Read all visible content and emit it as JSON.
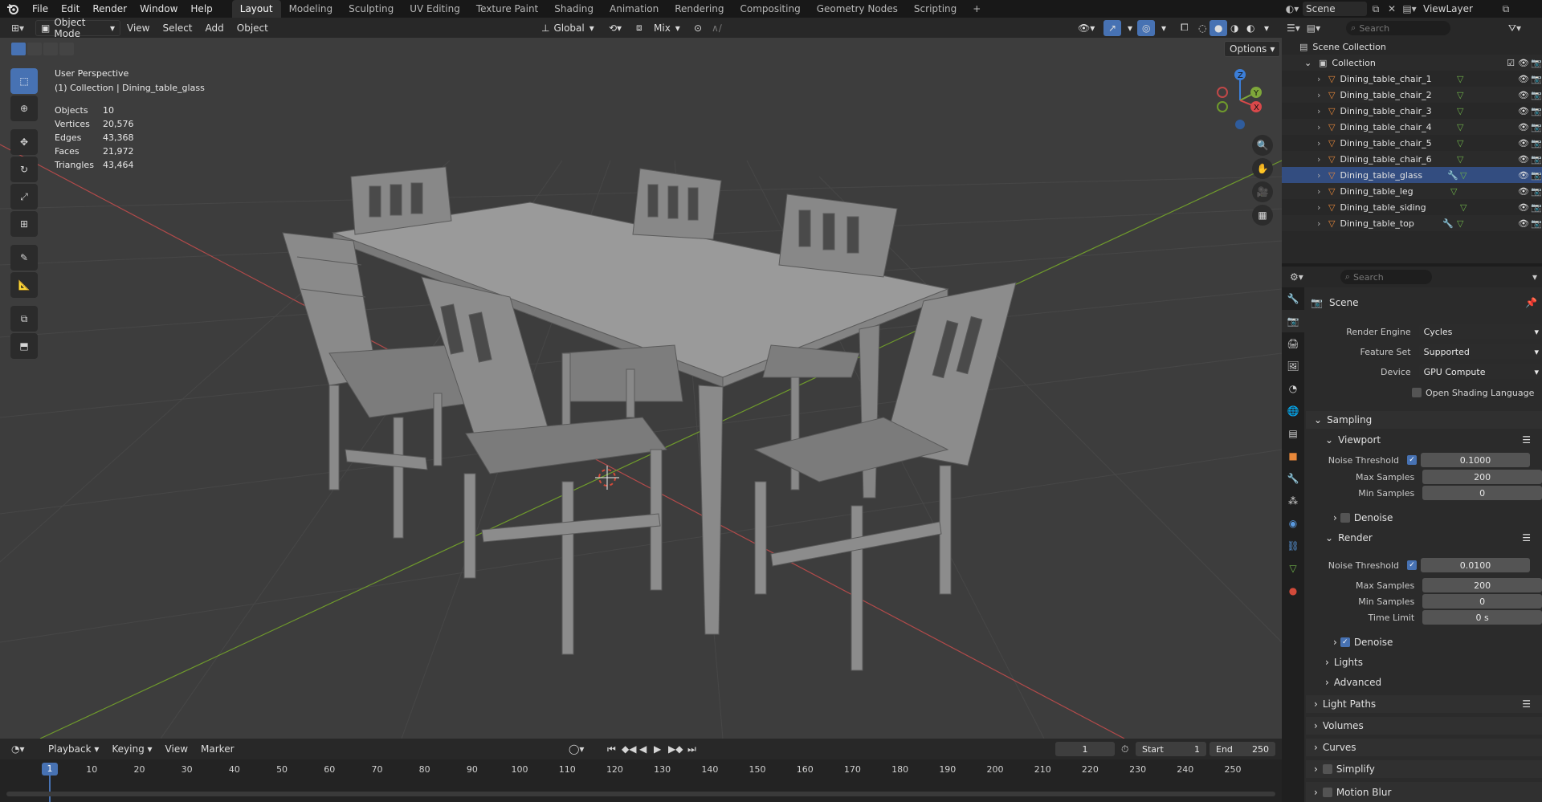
{
  "topbar": {
    "menus": [
      "File",
      "Edit",
      "Render",
      "Window",
      "Help"
    ],
    "workspaces": [
      "Layout",
      "Modeling",
      "Sculpting",
      "UV Editing",
      "Texture Paint",
      "Shading",
      "Animation",
      "Rendering",
      "Compositing",
      "Geometry Nodes",
      "Scripting"
    ],
    "active_workspace": "Layout",
    "add_tab": "+",
    "scene_name": "Scene",
    "view_layer": "ViewLayer"
  },
  "viewport_header": {
    "mode": "Object Mode",
    "menus": [
      "View",
      "Select",
      "Add",
      "Object"
    ],
    "orientation": "Global",
    "snap": "Mix",
    "options": "Options"
  },
  "overlay": {
    "perspective": "User Perspective",
    "collection_path": "(1) Collection | Dining_table_glass",
    "stats": [
      {
        "label": "Objects",
        "value": "10"
      },
      {
        "label": "Vertices",
        "value": "20,576"
      },
      {
        "label": "Edges",
        "value": "43,368"
      },
      {
        "label": "Faces",
        "value": "21,972"
      },
      {
        "label": "Triangles",
        "value": "43,464"
      }
    ]
  },
  "gizmo": {
    "z": "Z",
    "y": "Y",
    "x": "X"
  },
  "outliner": {
    "search_placeholder": "Search",
    "root": "Scene Collection",
    "collection": "Collection",
    "items": [
      {
        "name": "Dining_table_chair_1",
        "selected": false
      },
      {
        "name": "Dining_table_chair_2",
        "selected": false
      },
      {
        "name": "Dining_table_chair_3",
        "selected": false
      },
      {
        "name": "Dining_table_chair_4",
        "selected": false
      },
      {
        "name": "Dining_table_chair_5",
        "selected": false
      },
      {
        "name": "Dining_table_chair_6",
        "selected": false
      },
      {
        "name": "Dining_table_glass",
        "selected": true
      },
      {
        "name": "Dining_table_leg",
        "selected": false
      },
      {
        "name": "Dining_table_siding",
        "selected": false
      },
      {
        "name": "Dining_table_top",
        "selected": false
      }
    ]
  },
  "properties": {
    "search_placeholder": "Search",
    "context": "Scene",
    "render_engine_label": "Render Engine",
    "render_engine": "Cycles",
    "feature_set_label": "Feature Set",
    "feature_set": "Supported",
    "device_label": "Device",
    "device": "GPU Compute",
    "osl_label": "Open Shading Language",
    "sampling": "Sampling",
    "viewport": "Viewport",
    "viewport_noise_label": "Noise Threshold",
    "viewport_noise": "0.1000",
    "viewport_max_label": "Max Samples",
    "viewport_max": "200",
    "viewport_min_label": "Min Samples",
    "viewport_min": "0",
    "viewport_denoise": "Denoise",
    "render": "Render",
    "render_noise_label": "Noise Threshold",
    "render_noise": "0.0100",
    "render_max_label": "Max Samples",
    "render_max": "200",
    "render_min_label": "Min Samples",
    "render_min": "0",
    "time_limit_label": "Time Limit",
    "time_limit": "0 s",
    "render_denoise": "Denoise",
    "lights": "Lights",
    "advanced": "Advanced",
    "light_paths": "Light Paths",
    "volumes": "Volumes",
    "curves": "Curves",
    "simplify": "Simplify",
    "motion_blur": "Motion Blur"
  },
  "timeline": {
    "menus": [
      "Playback",
      "Keying",
      "View",
      "Marker"
    ],
    "current_frame": "1",
    "start_label": "Start",
    "start": "1",
    "end_label": "End",
    "end": "250",
    "ruler": [
      "1",
      "10",
      "20",
      "30",
      "40",
      "50",
      "60",
      "70",
      "80",
      "90",
      "100",
      "110",
      "120",
      "130",
      "140",
      "150",
      "160",
      "170",
      "180",
      "190",
      "200",
      "210",
      "220",
      "230",
      "240",
      "250"
    ]
  },
  "colors": {
    "accent": "#4772b3",
    "selected_row": "#334d80",
    "x_axis": "#c04848",
    "y_axis": "#6f9a2c",
    "object_icon": "#e8883a"
  }
}
